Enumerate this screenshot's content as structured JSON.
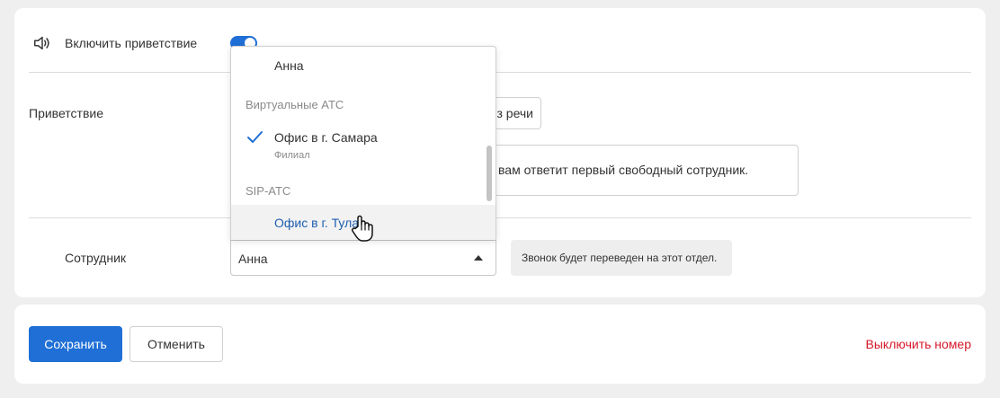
{
  "greeting_toggle": {
    "icon": "speaker-icon",
    "label": "Включить приветствие",
    "enabled": true,
    "accent": "#1f6fd6"
  },
  "greeting": {
    "label": "Приветствие",
    "speech_button_label": "з речи",
    "text_value": "вам ответит первый свободный сотрудник."
  },
  "employee": {
    "label": "Сотрудник",
    "selected": "Анна",
    "hint": "Звонок будет переведен на этот отдел."
  },
  "dropdown": {
    "items": [
      {
        "label": "Анна"
      }
    ],
    "groups": [
      {
        "label": "Виртуальные АТС",
        "items": [
          {
            "label": "Офис в г. Самара",
            "sublabel": "Филиал",
            "selected": true
          }
        ]
      },
      {
        "label": "SIP-АТС",
        "items": [
          {
            "label": "Офис в г. Тула",
            "hovered": true
          }
        ]
      }
    ]
  },
  "footer": {
    "save_label": "Сохранить",
    "cancel_label": "Отменить",
    "disable_label": "Выключить номер",
    "danger_color": "#d6182a"
  }
}
